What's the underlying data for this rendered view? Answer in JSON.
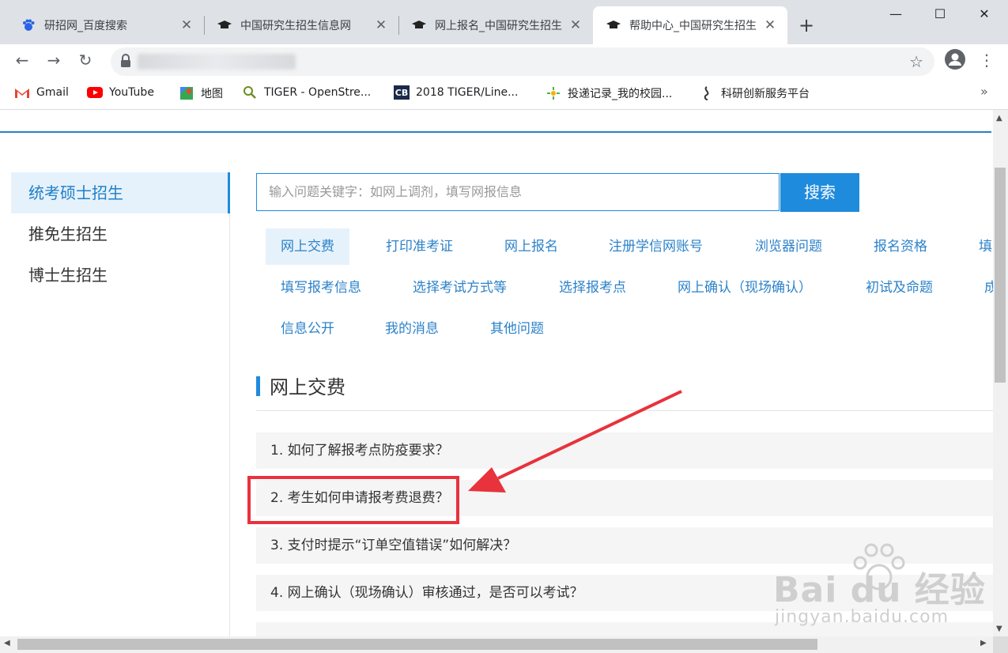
{
  "tabs": [
    {
      "title": "研招网_百度搜索",
      "icon": "baidu-paw-icon"
    },
    {
      "title": "中国研究生招生信息网",
      "icon": "graduation-cap-icon"
    },
    {
      "title": "网上报名_中国研究生招生",
      "icon": "graduation-cap-icon"
    },
    {
      "title": "帮助中心_中国研究生招生",
      "icon": "graduation-cap-icon",
      "active": true
    }
  ],
  "toolbar": {
    "new_tab": "+",
    "back": "←",
    "forward": "→",
    "reload": "↻",
    "star": "☆",
    "menu": "⋮"
  },
  "window": {
    "minimize": "—",
    "maximize": "☐",
    "close": "✕"
  },
  "bookmarks": [
    {
      "label": "Gmail",
      "icon": "gmail-icon"
    },
    {
      "label": "YouTube",
      "icon": "youtube-icon"
    },
    {
      "label": "地图",
      "icon": "maps-icon"
    },
    {
      "label": "TIGER - OpenStre...",
      "icon": "tiger-icon"
    },
    {
      "label": "2018 TIGER/Line...",
      "icon": "census-cb-icon"
    },
    {
      "label": "投递记录_我的校园...",
      "icon": "campus-icon"
    },
    {
      "label": "科研创新服务平台",
      "icon": "research-platform-icon"
    }
  ],
  "bookmarks_more": "»",
  "sidebar": {
    "items": [
      {
        "label": "统考硕士招生",
        "active": true
      },
      {
        "label": "推免生招生"
      },
      {
        "label": "博士生招生"
      }
    ]
  },
  "search": {
    "placeholder": "输入问题关键字：如网上调剂，填写网报信息",
    "button": "搜索"
  },
  "categories": {
    "row1": [
      "网上交费",
      "打印准考证",
      "网上报名",
      "注册学信网账号",
      "浏览器问题",
      "报名资格",
      "填"
    ],
    "row2": [
      "填写报考信息",
      "选择考试方式等",
      "选择报考点",
      "网上确认（现场确认）",
      "初试及命题",
      "成"
    ],
    "row3": [
      "信息公开",
      "我的消息",
      "其他问题"
    ],
    "active": "网上交费"
  },
  "section": {
    "title": "网上交费"
  },
  "questions": [
    "1. 如何了解报考点防疫要求？",
    "2. 考生如何申请报考费退费？",
    "3. 支付时提示“订单空值错误”如何解决？",
    "4. 网上确认（现场确认）审核通过，是否可以考试？"
  ],
  "annotation": {
    "highlight_color": "#e8323c",
    "highlighted_question": 2
  },
  "watermark": {
    "main": "Bai du 经验",
    "sub": "jingyan.baidu.com"
  },
  "colors": {
    "accent": "#1f8bdc",
    "link": "#2c82c9",
    "active_bg": "#e6f2fb"
  }
}
